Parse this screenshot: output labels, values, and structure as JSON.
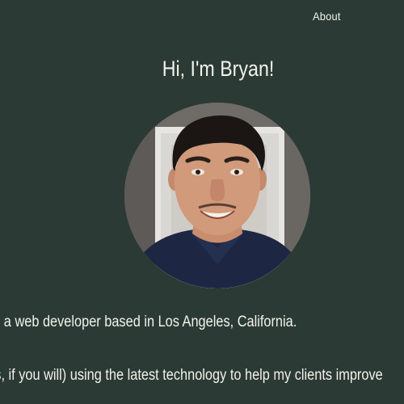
{
  "nav": {
    "about_label": "About"
  },
  "hero": {
    "title": "Hi, I'm Bryan!"
  },
  "bio": {
    "line_1": "I'm a web developer based in Los Angeles, California.",
    "line_2": "I build websites (and web apps, if you will) using the latest technology to help my clients improve"
  },
  "colors": {
    "background": "#2c3a35",
    "text": "#f2f2ec"
  }
}
